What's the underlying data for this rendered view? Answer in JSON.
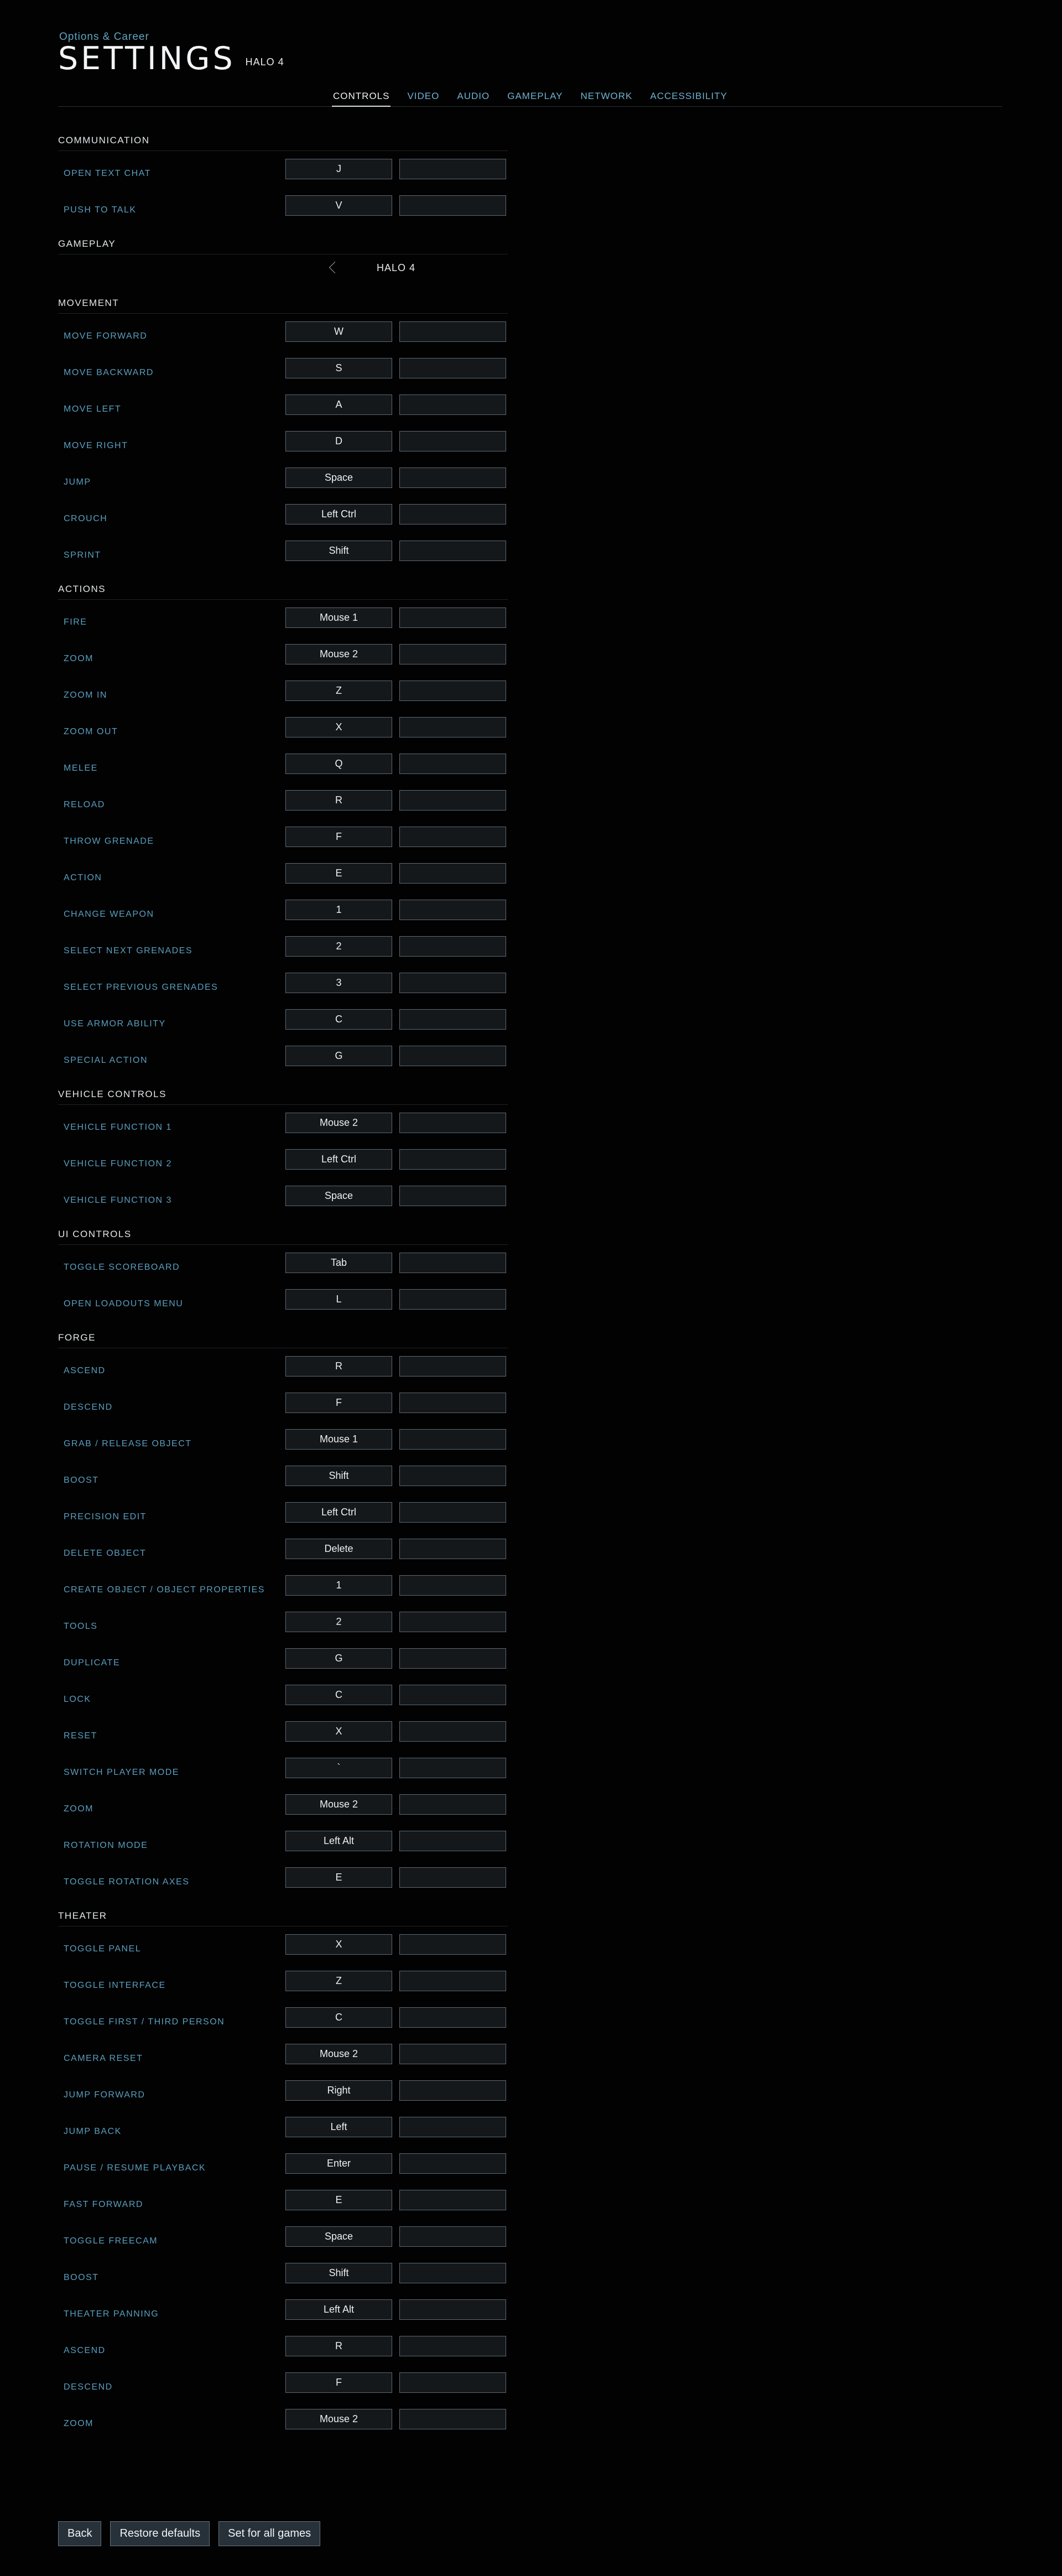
{
  "header": {
    "breadcrumb": "Options & Career",
    "title": "SETTINGS",
    "subtitle": "HALO 4"
  },
  "tabs": [
    {
      "label": "CONTROLS",
      "active": true
    },
    {
      "label": "VIDEO",
      "active": false
    },
    {
      "label": "AUDIO",
      "active": false
    },
    {
      "label": "GAMEPLAY",
      "active": false
    },
    {
      "label": "NETWORK",
      "active": false
    },
    {
      "label": "ACCESSIBILITY",
      "active": false
    }
  ],
  "sections": [
    {
      "title": "COMMUNICATION",
      "rows": [
        {
          "label": "OPEN TEXT CHAT",
          "primary": "J",
          "secondary": ""
        },
        {
          "label": "PUSH TO TALK",
          "primary": "V",
          "secondary": ""
        }
      ]
    },
    {
      "title": "GAMEPLAY",
      "selector": {
        "value": "HALO 4"
      },
      "rows": []
    },
    {
      "title": "MOVEMENT",
      "rows": [
        {
          "label": "MOVE FORWARD",
          "primary": "W",
          "secondary": ""
        },
        {
          "label": "MOVE BACKWARD",
          "primary": "S",
          "secondary": ""
        },
        {
          "label": "MOVE LEFT",
          "primary": "A",
          "secondary": ""
        },
        {
          "label": "MOVE RIGHT",
          "primary": "D",
          "secondary": ""
        },
        {
          "label": "JUMP",
          "primary": "Space",
          "secondary": ""
        },
        {
          "label": "CROUCH",
          "primary": "Left Ctrl",
          "secondary": ""
        },
        {
          "label": "SPRINT",
          "primary": "Shift",
          "secondary": ""
        }
      ]
    },
    {
      "title": "ACTIONS",
      "rows": [
        {
          "label": "FIRE",
          "primary": "Mouse 1",
          "secondary": ""
        },
        {
          "label": "ZOOM",
          "primary": "Mouse 2",
          "secondary": ""
        },
        {
          "label": "ZOOM IN",
          "primary": "Z",
          "secondary": ""
        },
        {
          "label": "ZOOM OUT",
          "primary": "X",
          "secondary": ""
        },
        {
          "label": "MELEE",
          "primary": "Q",
          "secondary": ""
        },
        {
          "label": "RELOAD",
          "primary": "R",
          "secondary": ""
        },
        {
          "label": "THROW GRENADE",
          "primary": "F",
          "secondary": ""
        },
        {
          "label": "ACTION",
          "primary": "E",
          "secondary": ""
        },
        {
          "label": "CHANGE WEAPON",
          "primary": "1",
          "secondary": ""
        },
        {
          "label": "SELECT NEXT GRENADES",
          "primary": "2",
          "secondary": ""
        },
        {
          "label": "SELECT PREVIOUS GRENADES",
          "primary": "3",
          "secondary": ""
        },
        {
          "label": "USE ARMOR ABILITY",
          "primary": "C",
          "secondary": ""
        },
        {
          "label": "SPECIAL ACTION",
          "primary": "G",
          "secondary": ""
        }
      ]
    },
    {
      "title": "VEHICLE CONTROLS",
      "rows": [
        {
          "label": "VEHICLE FUNCTION 1",
          "primary": "Mouse 2",
          "secondary": ""
        },
        {
          "label": "VEHICLE FUNCTION 2",
          "primary": "Left Ctrl",
          "secondary": ""
        },
        {
          "label": "VEHICLE FUNCTION 3",
          "primary": "Space",
          "secondary": ""
        }
      ]
    },
    {
      "title": "UI CONTROLS",
      "rows": [
        {
          "label": "TOGGLE SCOREBOARD",
          "primary": "Tab",
          "secondary": ""
        },
        {
          "label": "OPEN LOADOUTS MENU",
          "primary": "L",
          "secondary": ""
        }
      ]
    },
    {
      "title": "FORGE",
      "rows": [
        {
          "label": "ASCEND",
          "primary": "R",
          "secondary": ""
        },
        {
          "label": "DESCEND",
          "primary": "F",
          "secondary": ""
        },
        {
          "label": "GRAB / RELEASE OBJECT",
          "primary": "Mouse 1",
          "secondary": ""
        },
        {
          "label": "BOOST",
          "primary": "Shift",
          "secondary": ""
        },
        {
          "label": "PRECISION EDIT",
          "primary": "Left Ctrl",
          "secondary": ""
        },
        {
          "label": "DELETE OBJECT",
          "primary": "Delete",
          "secondary": ""
        },
        {
          "label": "CREATE OBJECT / OBJECT PROPERTIES",
          "primary": "1",
          "secondary": ""
        },
        {
          "label": "TOOLS",
          "primary": "2",
          "secondary": ""
        },
        {
          "label": "DUPLICATE",
          "primary": "G",
          "secondary": ""
        },
        {
          "label": "LOCK",
          "primary": "C",
          "secondary": ""
        },
        {
          "label": "RESET",
          "primary": "X",
          "secondary": ""
        },
        {
          "label": "SWITCH PLAYER MODE",
          "primary": "`",
          "secondary": ""
        },
        {
          "label": "ZOOM",
          "primary": "Mouse 2",
          "secondary": ""
        },
        {
          "label": "ROTATION MODE",
          "primary": "Left Alt",
          "secondary": ""
        },
        {
          "label": "TOGGLE ROTATION AXES",
          "primary": "E",
          "secondary": ""
        }
      ]
    },
    {
      "title": "THEATER",
      "rows": [
        {
          "label": "TOGGLE PANEL",
          "primary": "X",
          "secondary": ""
        },
        {
          "label": "TOGGLE INTERFACE",
          "primary": "Z",
          "secondary": ""
        },
        {
          "label": "TOGGLE FIRST / THIRD PERSON",
          "primary": "C",
          "secondary": ""
        },
        {
          "label": "CAMERA RESET",
          "primary": "Mouse 2",
          "secondary": ""
        },
        {
          "label": "JUMP FORWARD",
          "primary": "Right",
          "secondary": ""
        },
        {
          "label": "JUMP BACK",
          "primary": "Left",
          "secondary": ""
        },
        {
          "label": "PAUSE / RESUME PLAYBACK",
          "primary": "Enter",
          "secondary": ""
        },
        {
          "label": "FAST FORWARD",
          "primary": "E",
          "secondary": ""
        },
        {
          "label": "TOGGLE FREECAM",
          "primary": "Space",
          "secondary": ""
        },
        {
          "label": "BOOST",
          "primary": "Shift",
          "secondary": ""
        },
        {
          "label": "THEATER PANNING",
          "primary": "Left Alt",
          "secondary": ""
        },
        {
          "label": "ASCEND",
          "primary": "R",
          "secondary": ""
        },
        {
          "label": "DESCEND",
          "primary": "F",
          "secondary": ""
        },
        {
          "label": "ZOOM",
          "primary": "Mouse 2",
          "secondary": ""
        }
      ]
    }
  ],
  "footer": {
    "back_label": "Back",
    "restore_label": "Restore defaults",
    "set_all_label": "Set for all games"
  }
}
